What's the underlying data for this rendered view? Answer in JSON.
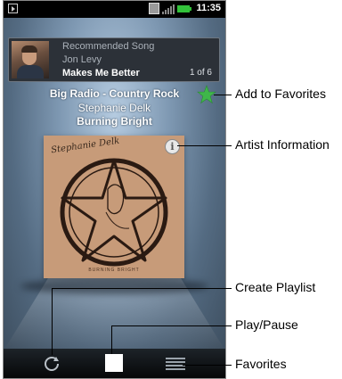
{
  "status_bar": {
    "time": "11:35"
  },
  "recommended": {
    "label": "Recommended Song",
    "artist": "Jon Levy",
    "song": "Makes Me Better",
    "count": "1 of 6"
  },
  "now_playing": {
    "station": "Big Radio - Country Rock",
    "artist": "Stephanie Delk",
    "album": "Burning Bright"
  },
  "album_art": {
    "cover_text": "Stephanie Delk",
    "cover_subtitle": "BURNING BRIGHT"
  },
  "callouts": {
    "add_to_favorites": "Add to Favorites",
    "artist_information": "Artist Information",
    "create_playlist": "Create Playlist",
    "play_pause": "Play/Pause",
    "favorites": "Favorites"
  },
  "colors": {
    "star": "#3fb64a",
    "battery": "#32c23a"
  },
  "icons": {
    "star": "star-icon",
    "info": "info-icon",
    "playlist": "create-playlist-icon",
    "stop": "stop-icon",
    "list": "list-icon"
  }
}
